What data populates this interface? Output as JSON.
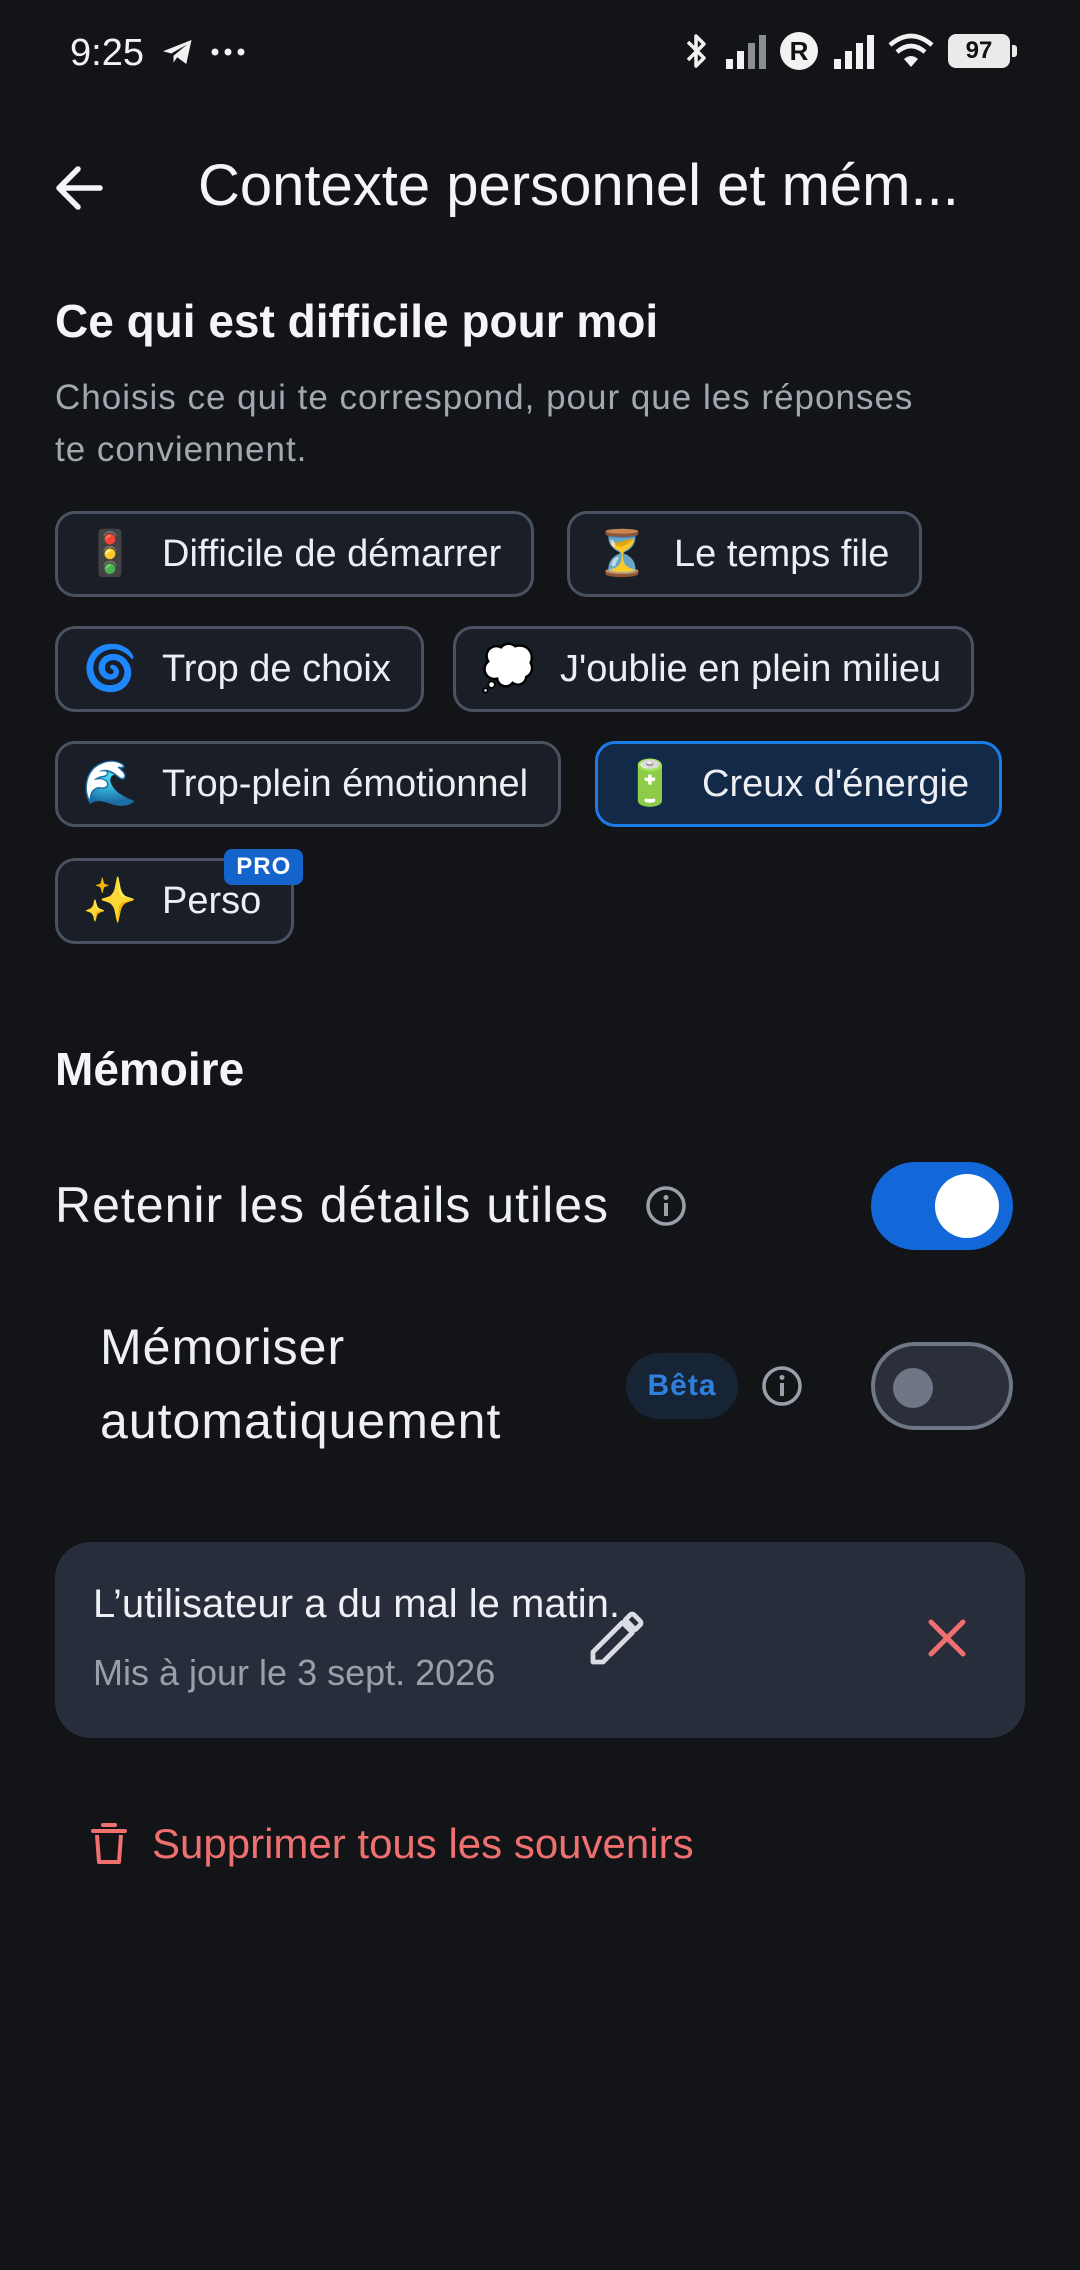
{
  "status_bar": {
    "time": "9:25",
    "battery": "97",
    "roaming_badge": "R",
    "left_icons": [
      "telegram-icon",
      "more-dots-icon"
    ],
    "right_icons": [
      "bluetooth-icon",
      "signal-icon",
      "roaming-icon",
      "signal-icon",
      "wifi-icon",
      "battery-icon"
    ]
  },
  "header": {
    "title": "Contexte personnel et mém..."
  },
  "difficulties": {
    "title": "Ce qui est difficile pour moi",
    "subtitle_line1": "Choisis ce qui te correspond, pour que les réponses",
    "subtitle_line2": "te conviennent.",
    "chips": [
      {
        "emoji": "🚦",
        "label": "Difficile de démarrer",
        "selected": false
      },
      {
        "emoji": "⏳",
        "label": "Le temps file",
        "selected": false
      },
      {
        "emoji": "🌀",
        "label": "Trop de choix",
        "selected": false
      },
      {
        "emoji": "💭",
        "label": "J'oublie en plein milieu",
        "selected": false
      },
      {
        "emoji": "🌊",
        "label": "Trop-plein émotionnel",
        "selected": false
      },
      {
        "emoji": "🔋",
        "label": "Creux d'énergie",
        "selected": true
      },
      {
        "emoji": "✨",
        "label": "Perso",
        "selected": false,
        "badge": "PRO"
      }
    ]
  },
  "memory": {
    "title": "Mémoire",
    "retain_label": "Retenir les détails utiles",
    "retain_enabled": true,
    "auto_label_line1": "Mémoriser",
    "auto_label_line2": "automatiquement",
    "auto_badge": "Bêta",
    "auto_enabled": false,
    "card": {
      "text": "L’utilisateur a du mal le matin.",
      "date": "Mis à jour le 3 sept. 2026"
    },
    "delete_all_label": "Supprimer tous les souvenirs"
  },
  "colors": {
    "background": "#121418",
    "accent": "#1268d8",
    "danger": "#f07070",
    "card": "#272d3b"
  }
}
